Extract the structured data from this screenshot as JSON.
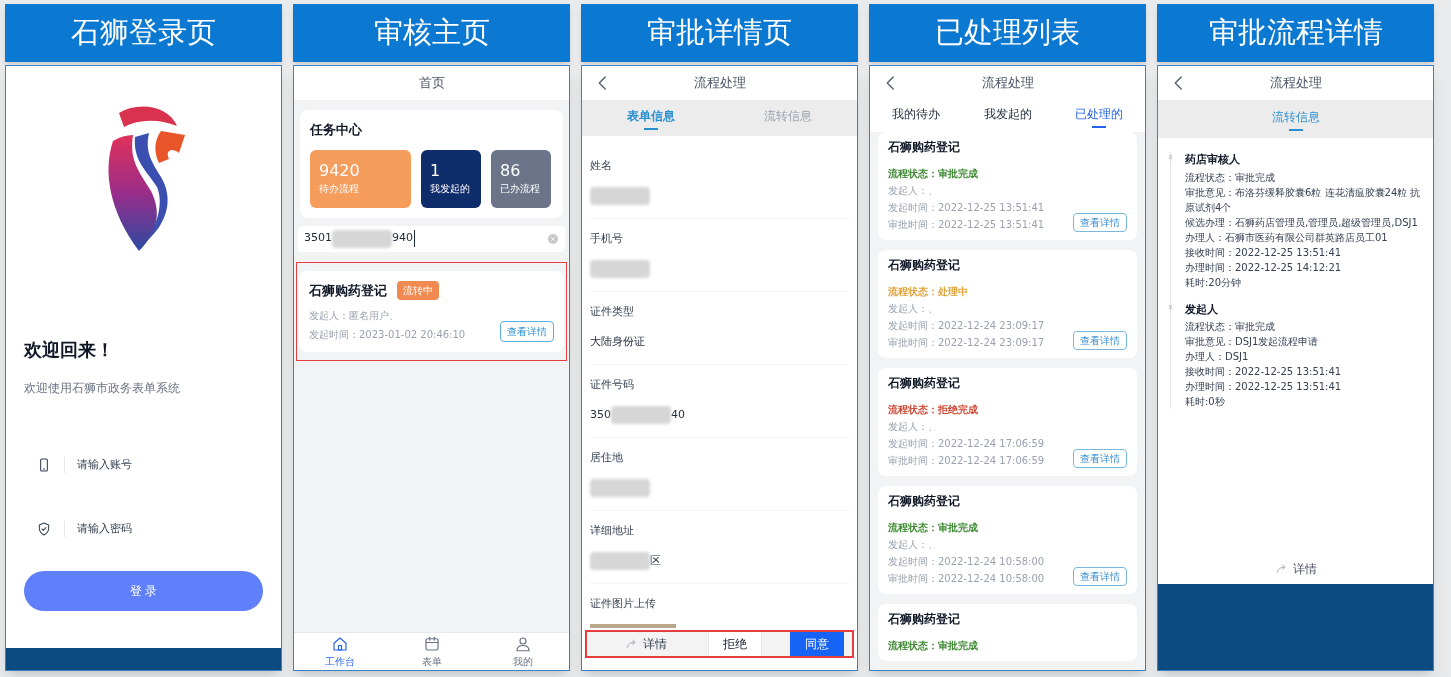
{
  "panels": [
    {
      "kind": "login",
      "caption": "石狮登录页",
      "welcome": "欢迎回来！",
      "subtitle": "欢迎使用石狮市政务表单系统",
      "fields": [
        {
          "placeholder": "请输入账号"
        },
        {
          "placeholder": "请输入密码"
        }
      ],
      "button": "登 录"
    },
    {
      "kind": "home",
      "caption": "审核主页",
      "title": "首页",
      "section": "任务中心",
      "stats": [
        {
          "value": "9420",
          "label": "待办流程",
          "color": "#f59d5c"
        },
        {
          "value": "1",
          "label": "我发起的",
          "color": "#0f2c6b"
        },
        {
          "value": "86",
          "label": "已办流程",
          "color": "#6c7489"
        }
      ],
      "search": {
        "value_start": "3501",
        "value_end": "940"
      },
      "card": {
        "title": "石狮购药登记",
        "badge": "流转中",
        "lines": [
          "发起人：匿名用户、",
          "发起时间：2023-01-02 20:46:10"
        ],
        "button": "查看详情",
        "highlighted": true
      },
      "tabbar": [
        {
          "label": "工作台",
          "selected": true
        },
        {
          "label": "表单",
          "selected": false
        },
        {
          "label": "我的",
          "selected": false
        }
      ]
    },
    {
      "kind": "detail",
      "caption": "审批详情页",
      "title": "流程处理",
      "tabs": [
        {
          "label": "表单信息",
          "selected": true
        },
        {
          "label": "流转信息",
          "selected": false
        }
      ],
      "fields": [
        {
          "label": "姓名",
          "kind": "redacted"
        },
        {
          "label": "手机号",
          "kind": "redacted"
        },
        {
          "label": "证件类型",
          "kind": "text",
          "value": "大陆身份证"
        },
        {
          "label": "证件号码",
          "kind": "partial",
          "start": "350",
          "end": "40"
        },
        {
          "label": "居住地",
          "kind": "redacted"
        },
        {
          "label": "详细地址",
          "kind": "partial",
          "end": "区"
        },
        {
          "label": "证件图片上传",
          "kind": "image"
        }
      ],
      "actions": [
        {
          "label": "详情",
          "kind": "link"
        },
        {
          "label": "拒绝",
          "kind": "secondary"
        },
        {
          "label": "同意",
          "kind": "primary"
        }
      ],
      "actions_highlighted": true
    },
    {
      "kind": "list",
      "caption": "已处理列表",
      "title": "流程处理",
      "tabs": [
        {
          "label": "我的待办",
          "selected": false
        },
        {
          "label": "我发起的",
          "selected": false
        },
        {
          "label": "已处理的",
          "selected": true
        }
      ],
      "items": [
        {
          "title": "石狮购药登记",
          "status": "流程状态：审批完成",
          "color": "#3f8a33",
          "lines": [
            "发起人：、",
            "发起时间：2022-12-25 13:51:41",
            "审批时间：2022-12-25 13:51:41"
          ],
          "button": "查看详情"
        },
        {
          "title": "石狮购药登记",
          "status": "流程状态：处理中",
          "color": "#e0a33a",
          "lines": [
            "发起人：、",
            "发起时间：2022-12-24 23:09:17",
            "审批时间：2022-12-24 23:09:17"
          ],
          "button": "查看详情"
        },
        {
          "title": "石狮购药登记",
          "status": "流程状态：拒绝完成",
          "color": "#cf4a36",
          "lines": [
            "发起人：、",
            "发起时间：2022-12-24 17:06:59",
            "审批时间：2022-12-24 17:06:59"
          ],
          "button": "查看详情"
        },
        {
          "title": "石狮购药登记",
          "status": "流程状态：审批完成",
          "color": "#3f8a33",
          "lines": [
            "发起人：、",
            "发起时间：2022-12-24 10:58:00",
            "审批时间：2022-12-24 10:58:00"
          ],
          "button": "查看详情"
        },
        {
          "title": "石狮购药登记",
          "status": "流程状态：审批完成",
          "color": "#3f8a33"
        }
      ]
    },
    {
      "kind": "flow",
      "caption": "审批流程详情",
      "title": "流程处理",
      "tabs": [
        {
          "label": "流转信息",
          "selected": true
        }
      ],
      "steps": [
        {
          "title": "药店审核人",
          "lines": [
            "流程状态：审批完成",
            "审批意见：布洛芬缓释胶囊6粒 连花清瘟胶囊24粒 抗原试剂4个",
            "候选办理：石狮药店管理员,管理员,超级管理员,DSJ1",
            "办理人：石狮市医药有限公司群英路店员工01",
            "接收时间：2022-12-25 13:51:41",
            "办理时间：2022-12-25 14:12:21",
            "耗时:20分钟"
          ]
        },
        {
          "title": "发起人",
          "lines": [
            "流程状态：审批完成",
            "审批意见：DSJ1发起流程申请",
            "办理人：DSJ1",
            "接收时间：2022-12-25 13:51:41",
            "办理时间：2022-12-25 13:51:41",
            "耗时:0秒"
          ]
        }
      ],
      "link": "详情"
    }
  ]
}
